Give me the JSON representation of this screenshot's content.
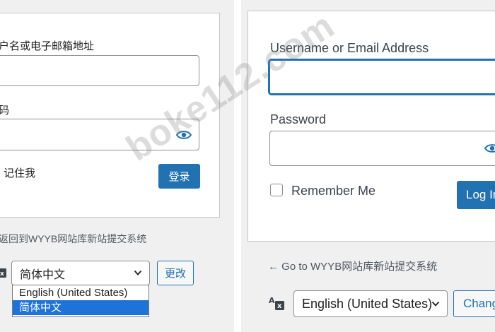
{
  "left": {
    "username_label": "户名或电子邮箱地址",
    "password_label": "码",
    "remember_label": "记住我",
    "login_button": "登录",
    "back_link": "返回到WYYB网站库新站提交系统",
    "language_select_value": "简体中文",
    "change_button": "更改",
    "dropdown_options": [
      "English (United States)",
      "简体中文"
    ],
    "dropdown_selected_index": 1
  },
  "right": {
    "username_label": "Username or Email Address",
    "password_label": "Password",
    "remember_label": "Remember Me",
    "login_button": "Log In",
    "back_link": "← Go to WYYB网站库新站提交系统",
    "language_select_value": "English (United States)",
    "change_button": "Change"
  },
  "watermark": "boke112.com",
  "icons": {
    "password_toggle": "eye-icon",
    "language": "translate-icon",
    "dropdown_arrow": "chevron-down-icon"
  },
  "colors": {
    "primary": "#2271b1",
    "background": "#f0f0f1",
    "card": "#ffffff",
    "dropdown_highlight": "#1e73d8"
  }
}
